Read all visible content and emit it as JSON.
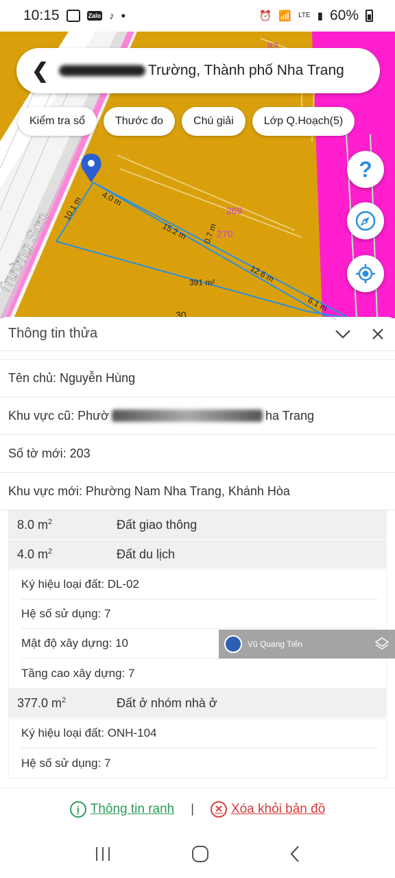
{
  "status": {
    "time": "10:15",
    "battery": "60%",
    "net_label": "LTE"
  },
  "search": {
    "title_suffix": "Trường, Thành phố Nha Trang"
  },
  "chips": [
    "Kiểm tra sổ",
    "Thước đo",
    "Chú giải",
    "Lớp Q.Hoạch(5)"
  ],
  "map": {
    "street": "Trường Sơn",
    "labels": [
      "10.1 m",
      "4.0 m",
      "15.2 m",
      "0.7 m",
      "12.6 m",
      "6.1 m",
      "391 m²",
      "269",
      "270",
      "83",
      "30"
    ],
    "colors": {
      "residential": "#d9a00c",
      "tourism": "#ff1fcf",
      "road": "#f2f2f2",
      "boundary": "#2b8fe0"
    }
  },
  "panel": {
    "title": "Thông tin thửa",
    "owner": "Tên chủ: Nguyễn Hùng",
    "old_area_prefix": "Khu vực cũ: Phườ",
    "old_area_suffix": "ha Trang",
    "new_sheet": "Số tờ mới: 203",
    "new_area": "Khu vực mới: Phường Nam Nha Trang, Khánh Hòa"
  },
  "land_use": [
    {
      "area": "8.0 m",
      "type": "Đất giao thông"
    },
    {
      "area": "4.0 m",
      "type": "Đất du lịch",
      "details": [
        "Ký hiệu loại đất: DL-02",
        "Hệ số sử dụng: 7",
        "Mật độ xây dựng: 10",
        "Tầng cao xây dựng: 7"
      ]
    },
    {
      "area": "377.0 m",
      "type": "Đất ở nhóm nhà ở",
      "details": [
        "Ký hiệu loại đất: ONH-104",
        "Hệ số sử dụng: 7"
      ]
    }
  ],
  "area_unit_sup": "2",
  "watermark": "Vũ Quang Tiến",
  "actions": {
    "info": "Thông tin ranh",
    "separator": "|",
    "delete": "Xóa khỏi bản đồ"
  }
}
